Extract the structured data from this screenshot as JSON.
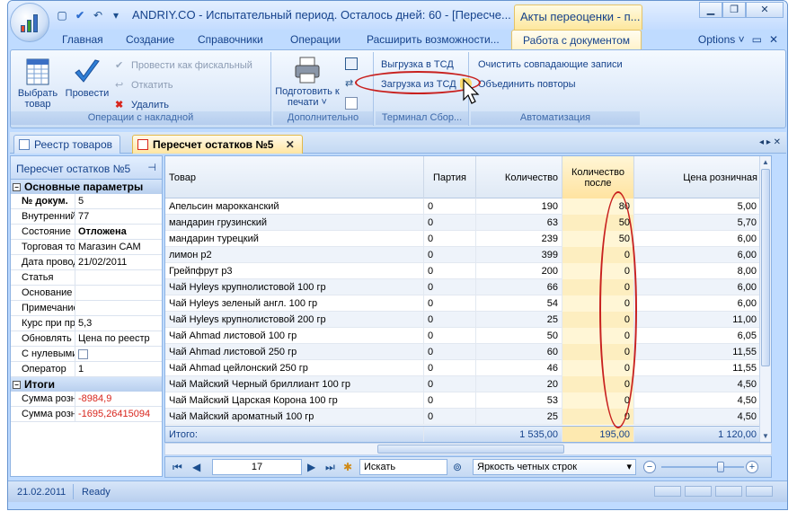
{
  "window": {
    "title": "ANDRIY.CO - Испытательный период. Осталось дней: 60 - [Пересче...",
    "context_title": "Акты переоценки - п...",
    "btn_minimize": "▁",
    "btn_maximize": "❐",
    "btn_close": "✕"
  },
  "ribbon_tabs": [
    "Главная",
    "Создание",
    "Справочники",
    "Операции",
    "Расширить возможности...",
    "Работа с документом"
  ],
  "ribbon_right": {
    "options": "Options ˅",
    "min": "▭",
    "close": "✕"
  },
  "ribbon": {
    "group1": {
      "label": "Операции с накладной",
      "select_goods": "Выбрать товар",
      "post": "Провести",
      "post_fiscal": "Провести как фискальный",
      "rollback": "Откатить",
      "delete": "Удалить"
    },
    "group2": {
      "label": "Дополнительно",
      "prepare_print": "Подготовить к печати ˅"
    },
    "group3": {
      "label": "Терминал Сбор...",
      "unload_tsd": "Выгрузка в ТСД",
      "load_tsd": "Загрузка из ТСД"
    },
    "group4": {
      "label": "Автоматизация",
      "clear_dups": "Очистить совпадающие записи",
      "merge_dups": "Объединить повторы"
    }
  },
  "doc_tabs": {
    "tab1": "Реестр товаров",
    "tab2": "Пересчет остатков №5",
    "close": "✕",
    "nav": "◂ ▸ ✕"
  },
  "left_panel": {
    "title": "Пересчет остатков №5",
    "pin": "📌",
    "section1": "Основные параметры",
    "section2": "Итоги",
    "props": [
      {
        "name": "№ докум.",
        "value": "5",
        "bold": true
      },
      {
        "name": "Внутренний н",
        "value": "77"
      },
      {
        "name": "Состояние",
        "value": "Отложена",
        "valbold": true
      },
      {
        "name": "Торговая точ",
        "value": "Магазин САМ"
      },
      {
        "name": "Дата провод",
        "value": "21/02/2011"
      },
      {
        "name": "Статья",
        "value": ""
      },
      {
        "name": "Основание",
        "value": ""
      },
      {
        "name": "Примечание",
        "value": ""
      },
      {
        "name": "Курс при про",
        "value": "5,3"
      },
      {
        "name": "Обновлять п",
        "value": "Цена по реестр"
      },
      {
        "name": "С нулевыми о",
        "value": "",
        "checkbox": true
      },
      {
        "name": "Оператор",
        "value": "1"
      }
    ],
    "totals": [
      {
        "name": "Сумма розни",
        "value": "-8984,9"
      },
      {
        "name": "Сумма розни",
        "value": "-1695,26415094"
      }
    ]
  },
  "grid": {
    "headers": {
      "product": "Товар",
      "batch": "Партия",
      "qty": "Количество",
      "qty_after": "Количество после",
      "price": "Цена розничная"
    },
    "rows": [
      {
        "product": "Апельсин марокканский",
        "batch": "0",
        "qty": "190",
        "after": "80",
        "price": "5,00"
      },
      {
        "product": "мандарин грузинский",
        "batch": "0",
        "qty": "63",
        "after": "50",
        "price": "5,70"
      },
      {
        "product": "мандарин турецкий",
        "batch": "0",
        "qty": "239",
        "after": "50",
        "price": "6,00"
      },
      {
        "product": "лимон р2",
        "batch": "0",
        "qty": "399",
        "after": "0",
        "price": "6,00"
      },
      {
        "product": "Грейпфрут р3",
        "batch": "0",
        "qty": "200",
        "after": "0",
        "price": "8,00"
      },
      {
        "product": "Чай Hyleys крупнолистовой 100 гр",
        "batch": "0",
        "qty": "66",
        "after": "0",
        "price": "6,00"
      },
      {
        "product": "Чай Hyleys зеленый англ. 100 гр",
        "batch": "0",
        "qty": "54",
        "after": "0",
        "price": "6,00"
      },
      {
        "product": "Чай Hyleys крупнолистовой 200 гр",
        "batch": "0",
        "qty": "25",
        "after": "0",
        "price": "11,00"
      },
      {
        "product": "Чай Ahmad листовой 100 гр",
        "batch": "0",
        "qty": "50",
        "after": "0",
        "price": "6,05"
      },
      {
        "product": "Чай Ahmad листовой 250 гр",
        "batch": "0",
        "qty": "60",
        "after": "0",
        "price": "11,55"
      },
      {
        "product": "Чай Ahmad цейлонский 250 гр",
        "batch": "0",
        "qty": "46",
        "after": "0",
        "price": "11,55"
      },
      {
        "product": "Чай Майский Черный бриллиант 100 гр",
        "batch": "0",
        "qty": "20",
        "after": "0",
        "price": "4,50"
      },
      {
        "product": "Чай Майский Царская Корона 100 гр",
        "batch": "0",
        "qty": "53",
        "after": "0",
        "price": "4,50"
      },
      {
        "product": "Чай Майский ароматный 100 гр",
        "batch": "0",
        "qty": "25",
        "after": "0",
        "price": "4,50"
      }
    ],
    "total": {
      "label": "Итого:",
      "qty": "1 535,00",
      "after": "195,00",
      "price": "1 120,00"
    }
  },
  "navbar": {
    "page": "17",
    "search_placeholder": "Искать",
    "highlight": "Яркость четных строк",
    "zoom_minus": "−",
    "zoom_plus": "+"
  },
  "status": {
    "date": "21.02.2011",
    "state": "Ready"
  }
}
